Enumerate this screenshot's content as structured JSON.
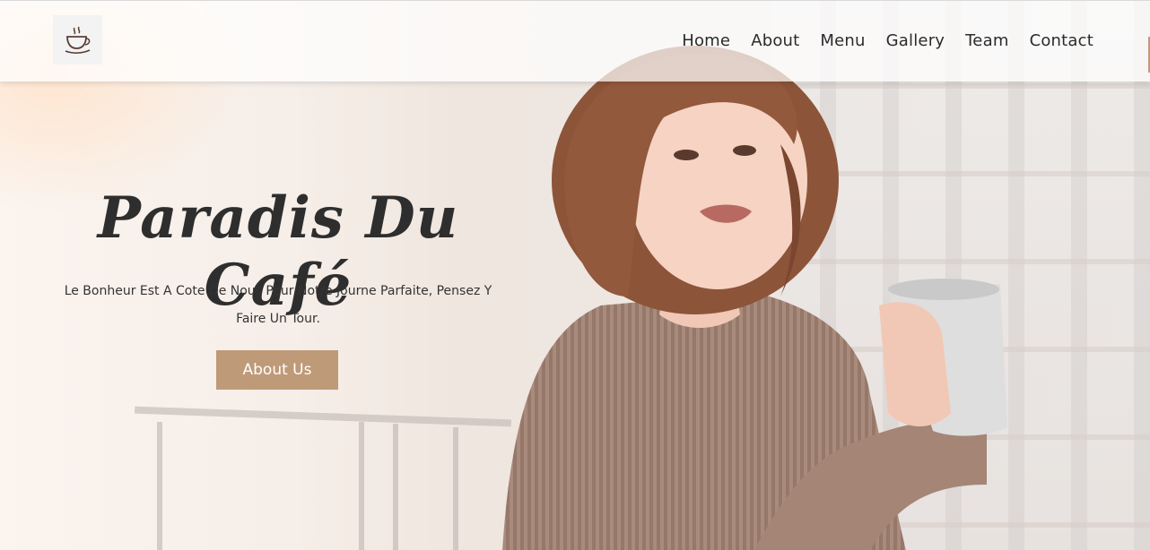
{
  "header": {
    "logo_icon": "coffee-cup-icon",
    "nav": [
      {
        "label": "Home"
      },
      {
        "label": "About"
      },
      {
        "label": "Menu"
      },
      {
        "label": "Gallery"
      },
      {
        "label": "Team"
      },
      {
        "label": "Contact"
      }
    ]
  },
  "hero": {
    "title": "Paradis Du Café",
    "subtitle": "Le Bonheur Est A Cote De Nous Pour Notre Journe Parfaite, Pensez Y Faire Un Tour.",
    "button_label": "About Us",
    "background_image": "woman-holding-coffee-mug-on-balcony"
  },
  "colors": {
    "accent": "#bf9a78",
    "title": "#2e2e2e",
    "nav_text": "#2b2b2b"
  }
}
